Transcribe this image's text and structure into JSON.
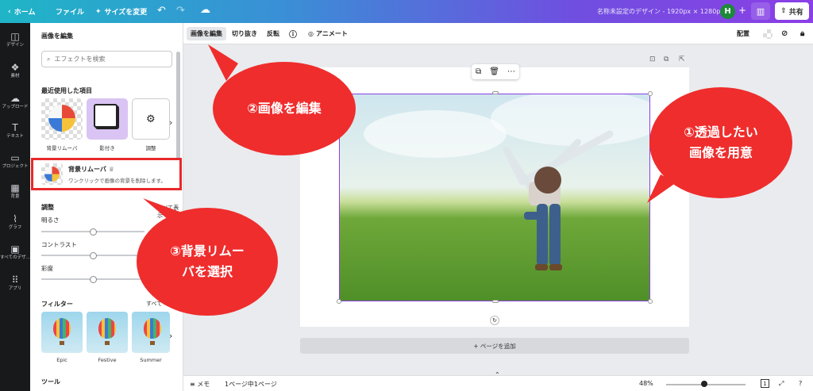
{
  "topbar": {
    "home": "ホーム",
    "file": "ファイル",
    "resize": "サイズを変更",
    "title": "名称未設定のデザイン - 1920px × 1280px",
    "avatar": "H",
    "share": "共有"
  },
  "rail": {
    "items": [
      "デザイン",
      "素材",
      "アップロード",
      "テキスト",
      "プロジェクト",
      "背景",
      "グラフ",
      "すべてのデザ...",
      "アプリ"
    ]
  },
  "panel": {
    "title": "画像を編集",
    "search_placeholder": "エフェクトを検索",
    "recent_heading": "最近使用した項目",
    "recent": [
      {
        "label": "背景リムーバ"
      },
      {
        "label": "影付き"
      },
      {
        "label": "調整"
      }
    ],
    "bg_remover": {
      "name": "背景リムーバ",
      "desc": "ワンクリックで画像の背景を削除します。"
    },
    "adjust": {
      "heading": "調整",
      "see_all": "すべて表示",
      "sliders": [
        {
          "label": "明るさ",
          "value": 0.5
        },
        {
          "label": "コントラスト",
          "value": 0.5
        },
        {
          "label": "彩度",
          "value": 0.5
        }
      ]
    },
    "filters": {
      "heading": "フィルター",
      "see_all": "すべて",
      "items": [
        "Epic",
        "Festive",
        "Summer"
      ]
    },
    "tools_heading": "ツール"
  },
  "context_toolbar": {
    "edit_image": "画像を編集",
    "crop": "切り抜き",
    "flip": "反転",
    "animate": "アニメート",
    "position": "配置"
  },
  "canvas": {
    "add_page": "+ ページを追加"
  },
  "bottombar": {
    "notes": "メモ",
    "pages": "1ページ中1ページ",
    "zoom": "48%",
    "zoom_level": 0.48,
    "page_number": "1"
  },
  "callouts": {
    "c1": "①透過したい\n画像を用意",
    "c2": "②画像を編集",
    "c3": "③背景リムー\nバを選択"
  },
  "colors": {
    "accent": "#8b3fe6",
    "callout": "#ef2d2d",
    "highlight": "#e8282a"
  }
}
